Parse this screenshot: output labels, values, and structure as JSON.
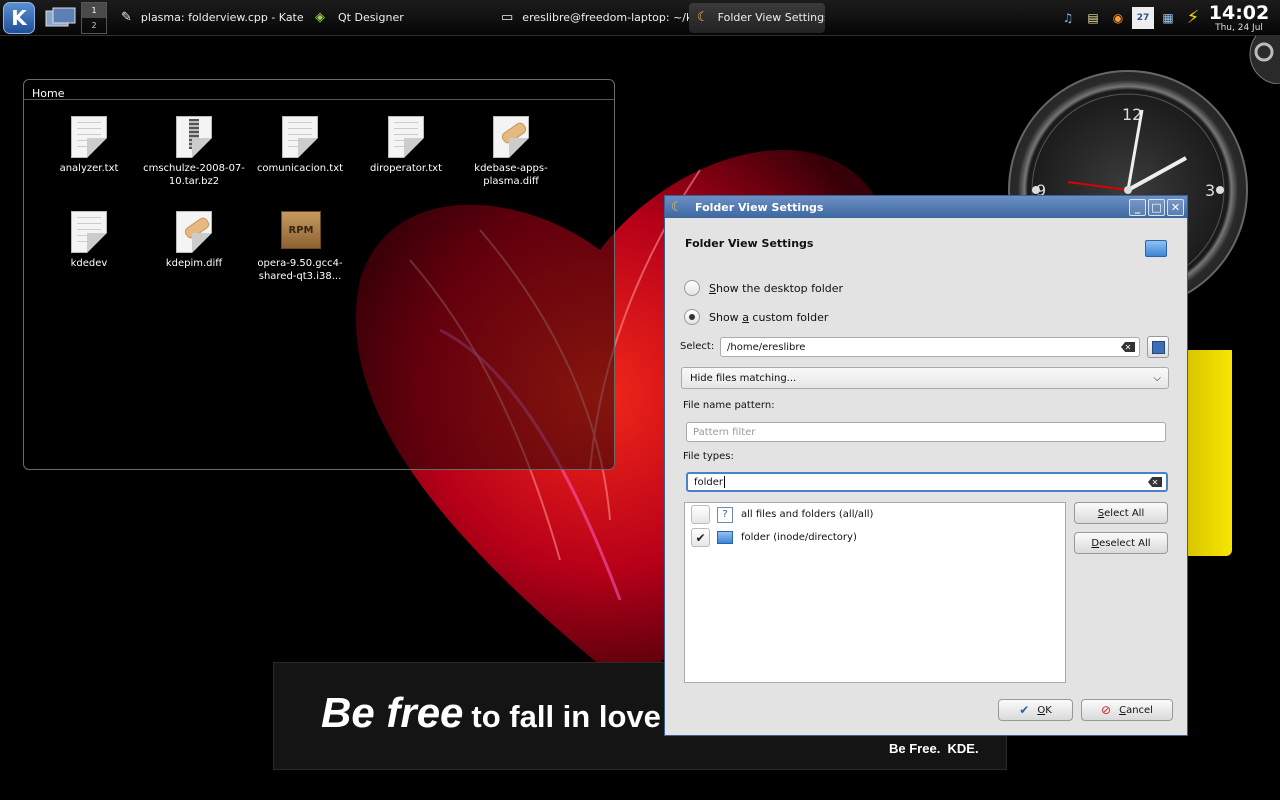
{
  "panel": {
    "launcher_icon": "kde-logo-icon",
    "pager": {
      "desk1": "1",
      "desk2": "2"
    },
    "tasks": [
      {
        "label": "plasma: folderview.cpp - Kate",
        "icon": "kate-icon"
      },
      {
        "label": "Qt Designer",
        "icon": "qt-designer-icon"
      },
      {
        "label": "ereslibre@freedom-laptop: ~/kde",
        "icon": "terminal-icon"
      },
      {
        "label": "Folder View Settings",
        "icon": "plasma-icon"
      }
    ],
    "clock": {
      "time": "14:02",
      "date": "Thu, 24 Jul"
    },
    "calendar_day": "27"
  },
  "folderview": {
    "title": "Home",
    "files": [
      {
        "name": "analyzer.txt",
        "type": "text"
      },
      {
        "name": "cmschulze-2008-07-10.tar.bz2",
        "type": "archive"
      },
      {
        "name": "comunicacion.txt",
        "type": "text"
      },
      {
        "name": "diroperator.txt",
        "type": "text"
      },
      {
        "name": "kdebase-apps-plasma.diff",
        "type": "patch"
      },
      {
        "name": "kdedev",
        "type": "text"
      },
      {
        "name": "kdepim.diff",
        "type": "patch"
      },
      {
        "name": "opera-9.50.gcc4-shared-qt3.i38...",
        "type": "rpm"
      }
    ]
  },
  "banner": {
    "big_a": "Be free",
    "big_b": "to fall in love",
    "small": "Be Free.  KDE."
  },
  "dialog": {
    "window_title": "Folder View Settings",
    "header": "Folder View Settings",
    "radio_desktop": {
      "pre": "",
      "acc": "S",
      "post": "how the desktop folder"
    },
    "radio_custom": {
      "pre": "Show ",
      "acc": "a",
      "post": " custom folder"
    },
    "select_label": "Select:",
    "select_value": "/home/ereslibre",
    "filter_combo": "Hide files matching...",
    "pattern_label": "File name pattern:",
    "pattern_placeholder": "Pattern filter",
    "types_label": "File types:",
    "types_value": "folder",
    "types": [
      {
        "label": "all files and folders (all/all)",
        "checked": false
      },
      {
        "label": "folder (inode/directory)",
        "checked": true
      }
    ],
    "select_all": {
      "acc": "S",
      "rest": "elect All"
    },
    "deselect_all": {
      "acc": "D",
      "rest": "eselect All"
    },
    "ok": {
      "acc": "O",
      "rest": "K"
    },
    "cancel": {
      "acc": "C",
      "rest": "ancel"
    }
  },
  "colors": {
    "accent": "#3d679f",
    "heart": "#c8001a"
  }
}
